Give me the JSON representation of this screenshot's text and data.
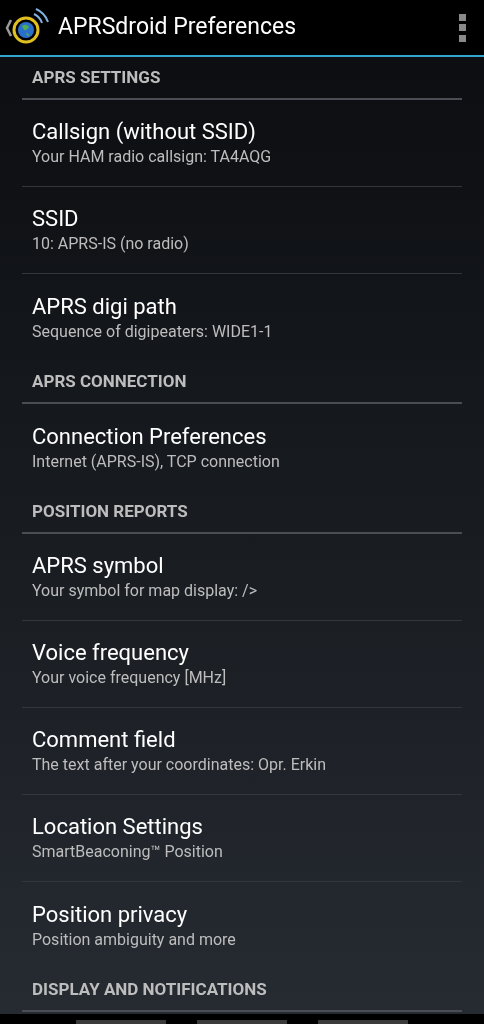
{
  "action_bar": {
    "title": "APRSdroid Preferences"
  },
  "sections": [
    {
      "title": "APRS SETTINGS",
      "items": [
        {
          "title": "Callsign (without SSID)",
          "summary": "Your HAM radio callsign: TA4AQG"
        },
        {
          "title": "SSID",
          "summary": "10: APRS-IS (no radio)"
        },
        {
          "title": "APRS digi path",
          "summary": "Sequence of digipeaters: WIDE1-1"
        }
      ]
    },
    {
      "title": "APRS CONNECTION",
      "items": [
        {
          "title": "Connection Preferences",
          "summary": "Internet (APRS-IS), TCP connection"
        }
      ]
    },
    {
      "title": "POSITION REPORTS",
      "items": [
        {
          "title": "APRS symbol",
          "summary": "Your symbol for map display: />"
        },
        {
          "title": "Voice frequency",
          "summary": "Your voice frequency [MHz]"
        },
        {
          "title": "Comment field",
          "summary": "The text after your coordinates: Opr. Erkin"
        },
        {
          "title": "Location Settings",
          "summary": "SmartBeaconing™ Position"
        },
        {
          "title": "Position privacy",
          "summary": "Position ambiguity and more"
        }
      ]
    },
    {
      "title": "DISPLAY AND NOTIFICATIONS"
    }
  ]
}
